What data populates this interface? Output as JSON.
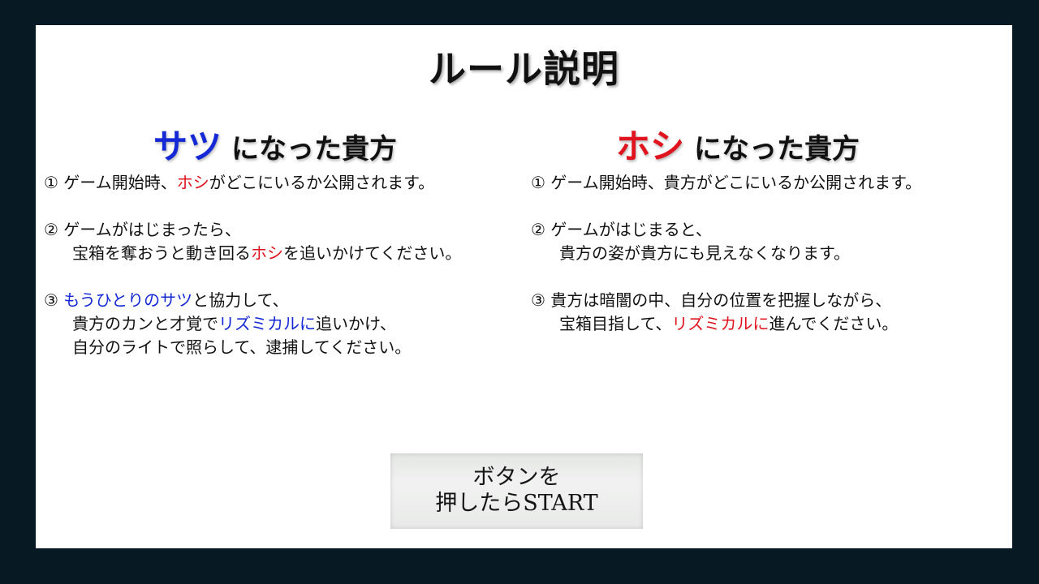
{
  "title": "ルール説明",
  "satsu": {
    "role": "サツ",
    "heading_rest": "になった貴方",
    "rules": [
      {
        "num": "①",
        "lines": [
          [
            {
              "t": "ゲーム開始時、",
              "c": ""
            },
            {
              "t": "ホシ",
              "c": "red"
            },
            {
              "t": "がどこにいるか公開されます。",
              "c": ""
            }
          ]
        ]
      },
      {
        "num": "②",
        "lines": [
          [
            {
              "t": "ゲームがはじまったら、",
              "c": ""
            }
          ],
          [
            {
              "t": "宝箱を奪おうと動き回る",
              "c": ""
            },
            {
              "t": "ホシ",
              "c": "red"
            },
            {
              "t": "を追いかけてください。",
              "c": ""
            }
          ]
        ]
      },
      {
        "num": "③",
        "lines": [
          [
            {
              "t": "もうひとりのサツ",
              "c": "blue"
            },
            {
              "t": "と協力して、",
              "c": ""
            }
          ],
          [
            {
              "t": "貴方のカンと才覚で",
              "c": ""
            },
            {
              "t": "リズミカルに",
              "c": "blue"
            },
            {
              "t": "追いかけ、",
              "c": ""
            }
          ],
          [
            {
              "t": "自分のライトで照らして、逮捕してください。",
              "c": ""
            }
          ]
        ]
      }
    ]
  },
  "hoshi": {
    "role": "ホシ",
    "heading_rest": "になった貴方",
    "rules": [
      {
        "num": "①",
        "lines": [
          [
            {
              "t": "ゲーム開始時、貴方がどこにいるか公開されます。",
              "c": ""
            }
          ]
        ]
      },
      {
        "num": "②",
        "lines": [
          [
            {
              "t": "ゲームがはじまると、",
              "c": ""
            }
          ],
          [
            {
              "t": "貴方の姿が貴方にも見えなくなります。",
              "c": ""
            }
          ]
        ]
      },
      {
        "num": "③",
        "lines": [
          [
            {
              "t": "貴方は暗闇の中、自分の位置を把握しながら、",
              "c": ""
            }
          ],
          [
            {
              "t": "宝箱目指して、",
              "c": ""
            },
            {
              "t": "リズミカルに",
              "c": "red"
            },
            {
              "t": "進んでください。",
              "c": ""
            }
          ]
        ]
      }
    ]
  },
  "start_button": {
    "line1": "ボタンを",
    "line2": "押したらSTART"
  },
  "colors": {
    "background": "#071a24",
    "panel": "#ffffff",
    "satsu_accent": "#1428d6",
    "hoshi_accent": "#e0141e"
  }
}
